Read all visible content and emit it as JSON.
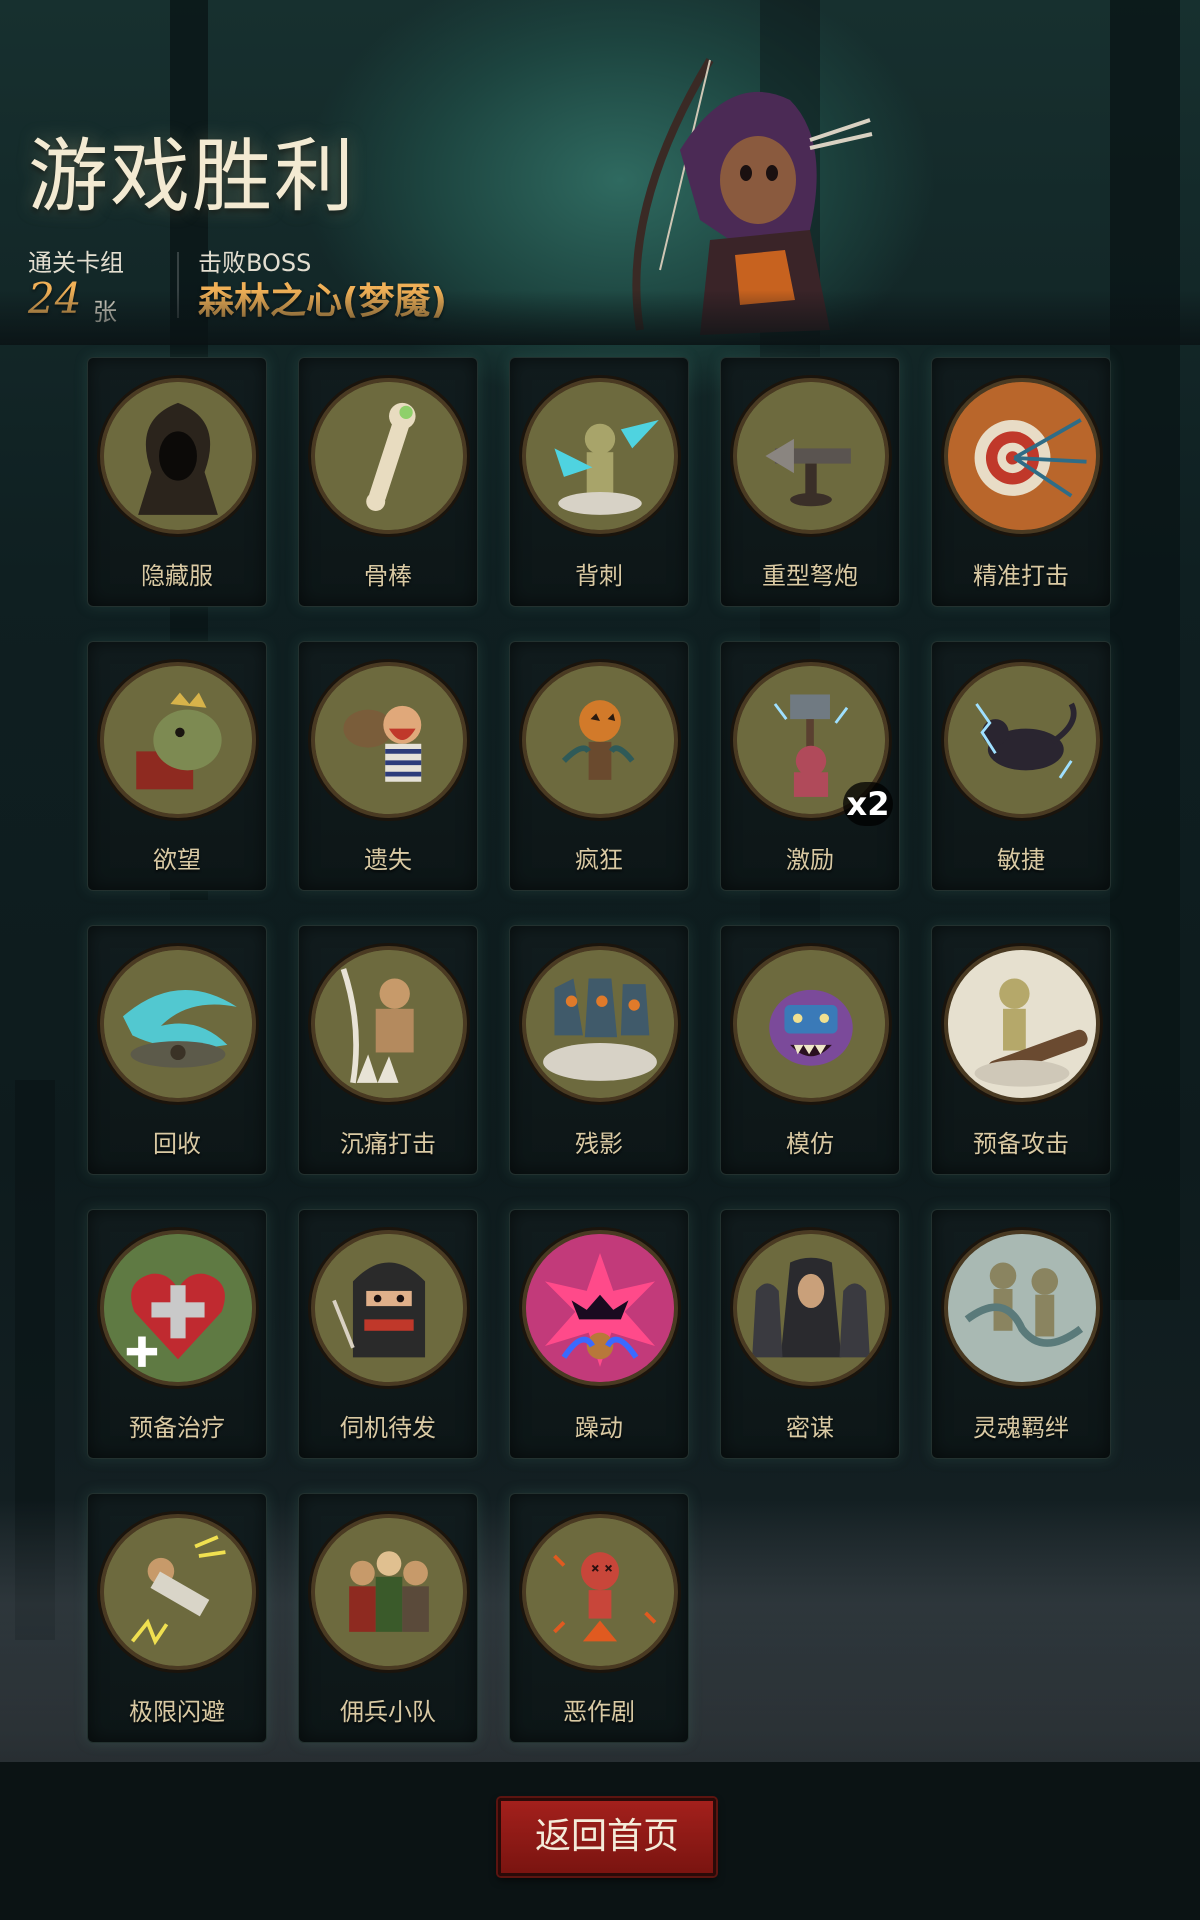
{
  "header": {
    "title": "游戏胜利",
    "deck_label": "通关卡组",
    "deck_count": "24",
    "deck_unit": "张",
    "boss_label": "击败BOSS",
    "boss_name": "森林之心(梦魇)"
  },
  "cards": [
    {
      "name": "隐藏服",
      "icon": "hood-cloak-icon",
      "bg": "#6d6a3e"
    },
    {
      "name": "骨棒",
      "icon": "bone-club-icon",
      "bg": "#6d6a3e"
    },
    {
      "name": "背刺",
      "icon": "backstab-icon",
      "bg": "#6d6a3e"
    },
    {
      "name": "重型弩炮",
      "icon": "ballista-icon",
      "bg": "#6d6a3e"
    },
    {
      "name": "精准打击",
      "icon": "target-arrows-icon",
      "bg": "#b9662b"
    },
    {
      "name": "欲望",
      "icon": "treasure-toad-icon",
      "bg": "#6d6a3e"
    },
    {
      "name": "遗失",
      "icon": "pirate-sack-icon",
      "bg": "#6d6a3e"
    },
    {
      "name": "疯狂",
      "icon": "pumpkin-scarecrow-icon",
      "bg": "#6d6a3e"
    },
    {
      "name": "激励",
      "icon": "hammer-warrior-icon",
      "bg": "#6d6a3e",
      "count": "x2"
    },
    {
      "name": "敏捷",
      "icon": "panther-icon",
      "bg": "#6d6a3e"
    },
    {
      "name": "回收",
      "icon": "whirlwind-icon",
      "bg": "#6d6a3e"
    },
    {
      "name": "沉痛打击",
      "icon": "brute-smash-icon",
      "bg": "#6d6a3e"
    },
    {
      "name": "残影",
      "icon": "afterimage-icon",
      "bg": "#6d6a3e"
    },
    {
      "name": "模仿",
      "icon": "masked-goblin-icon",
      "bg": "#6d6a3e"
    },
    {
      "name": "预备攻击",
      "icon": "puppet-club-icon",
      "bg": "#e6e0cf"
    },
    {
      "name": "预备治疗",
      "icon": "heart-cross-icon",
      "bg": "#5f7a43"
    },
    {
      "name": "伺机待发",
      "icon": "ninja-icon",
      "bg": "#6d6a3e"
    },
    {
      "name": "躁动",
      "icon": "frenzy-burst-icon",
      "bg": "#c23a7a"
    },
    {
      "name": "密谋",
      "icon": "hooded-conspirators-icon",
      "bg": "#6d6a3e"
    },
    {
      "name": "灵魂羁绊",
      "icon": "soul-bond-puppets-icon",
      "bg": "#a9b9b3"
    },
    {
      "name": "极限闪避",
      "icon": "dodge-flip-icon",
      "bg": "#6d6a3e"
    },
    {
      "name": "佣兵小队",
      "icon": "mercenary-squad-icon",
      "bg": "#6d6a3e"
    },
    {
      "name": "恶作剧",
      "icon": "voodoo-doll-icon",
      "bg": "#6d6a3e"
    }
  ],
  "footer": {
    "home_button_label": "返回首页"
  },
  "colors": {
    "accent_gold": "#f0b057",
    "button_red": "#9b1c18",
    "card_text": "#d9c9a3"
  }
}
